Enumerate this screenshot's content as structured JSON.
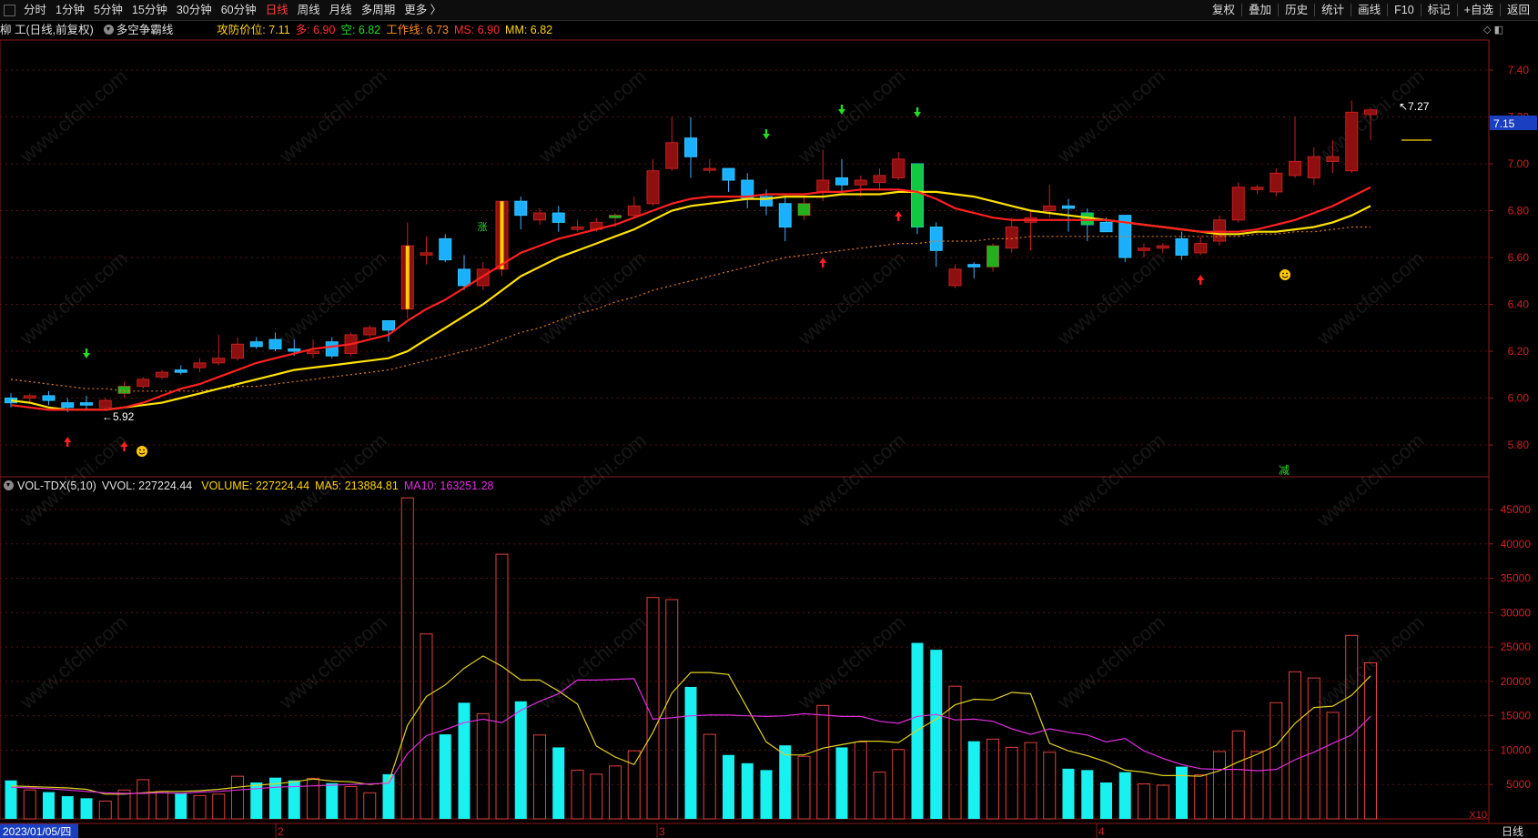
{
  "toolbar": {
    "left": [
      "分时",
      "1分钟",
      "5分钟",
      "15分钟",
      "30分钟",
      "60分钟",
      "日线",
      "周线",
      "月线",
      "多周期",
      "更多 〉"
    ],
    "active": "日线",
    "right": [
      "复权",
      "叠加",
      "历史",
      "统计",
      "画线",
      "F10",
      "标记",
      "+自选",
      "返回"
    ]
  },
  "header": {
    "stock": "柳 工(日线,前复权)",
    "indicator": "多空争霸线",
    "metrics": [
      {
        "label": "攻防价位: ",
        "value": "7.11",
        "color": "#ffd400"
      },
      {
        "label": "多: ",
        "value": "6.90",
        "color": "#ff3030"
      },
      {
        "label": "空: ",
        "value": "6.82",
        "color": "#22dd22"
      },
      {
        "label": "工作线: ",
        "value": "6.73",
        "color": "#ff8c1a"
      },
      {
        "label": "MS: ",
        "value": "6.90",
        "color": "#ff3030"
      },
      {
        "label": "MM: ",
        "value": "6.82",
        "color": "#ffd400"
      }
    ]
  },
  "volume_header": {
    "name": "VOL-TDX(5,10)",
    "vvol": "VVOL: 227224.44",
    "volume": "VOLUME: 227224.44",
    "ma5": "MA5: 213884.81",
    "ma10": "MA10: 163251.28"
  },
  "price_axis": [
    "7.40",
    "7.20",
    "7.00",
    "6.80",
    "6.60",
    "6.40",
    "6.20",
    "6.00",
    "5.80"
  ],
  "current_price": "7.15",
  "high_mark": "7.27",
  "low_mark": "5.92",
  "volume_axis": [
    "45000",
    "40000",
    "35000",
    "30000",
    "25000",
    "20000",
    "15000",
    "10000",
    "5000"
  ],
  "volume_unit": "X10",
  "date_axis": {
    "first": "2023/01/05/四",
    "months": [
      "2",
      "3",
      "4"
    ],
    "period": "日线"
  },
  "signal_texts": {
    "zhang": "涨",
    "jian": "减"
  },
  "chart_data": {
    "type": "candlestick",
    "ylim": [
      5.7,
      7.48
    ],
    "volume_ylim": [
      0,
      48000
    ],
    "candles": [
      [
        6.0,
        5.98,
        6.02,
        5.96
      ],
      [
        6.0,
        6.01,
        6.02,
        5.98
      ],
      [
        6.01,
        5.99,
        6.03,
        5.97
      ],
      [
        5.98,
        5.96,
        6.0,
        5.94
      ],
      [
        5.98,
        5.97,
        6.01,
        5.95
      ],
      [
        5.96,
        5.99,
        6.0,
        5.95
      ],
      [
        6.02,
        6.05,
        6.07,
        6.0
      ],
      [
        6.05,
        6.08,
        6.09,
        6.04
      ],
      [
        6.09,
        6.11,
        6.12,
        6.08
      ],
      [
        6.12,
        6.11,
        6.14,
        6.1
      ],
      [
        6.13,
        6.15,
        6.17,
        6.11
      ],
      [
        6.15,
        6.17,
        6.27,
        6.14
      ],
      [
        6.17,
        6.23,
        6.26,
        6.16
      ],
      [
        6.24,
        6.22,
        6.26,
        6.21
      ],
      [
        6.25,
        6.21,
        6.28,
        6.2
      ],
      [
        6.21,
        6.2,
        6.25,
        6.18
      ],
      [
        6.19,
        6.2,
        6.25,
        6.17
      ],
      [
        6.24,
        6.18,
        6.26,
        6.17
      ],
      [
        6.19,
        6.27,
        6.28,
        6.18
      ],
      [
        6.27,
        6.3,
        6.31,
        6.26
      ],
      [
        6.33,
        6.29,
        6.33,
        6.24
      ],
      [
        6.38,
        6.65,
        6.75,
        6.34
      ],
      [
        6.61,
        6.62,
        6.69,
        6.57
      ],
      [
        6.68,
        6.59,
        6.7,
        6.58
      ],
      [
        6.55,
        6.48,
        6.61,
        6.46
      ],
      [
        6.48,
        6.55,
        6.58,
        6.46
      ],
      [
        6.55,
        6.84,
        6.84,
        6.52
      ],
      [
        6.84,
        6.78,
        6.86,
        6.72
      ],
      [
        6.76,
        6.79,
        6.81,
        6.74
      ],
      [
        6.79,
        6.75,
        6.82,
        6.71
      ],
      [
        6.72,
        6.73,
        6.76,
        6.71
      ],
      [
        6.72,
        6.75,
        6.77,
        6.71
      ],
      [
        6.77,
        6.78,
        6.79,
        6.73
      ],
      [
        6.78,
        6.82,
        6.86,
        6.77
      ],
      [
        6.83,
        6.97,
        7.02,
        6.82
      ],
      [
        6.98,
        7.09,
        7.2,
        6.97
      ],
      [
        7.11,
        7.03,
        7.2,
        6.94
      ],
      [
        6.98,
        6.98,
        7.02,
        6.96
      ],
      [
        6.98,
        6.93,
        6.98,
        6.88
      ],
      [
        6.93,
        6.85,
        6.96,
        6.81
      ],
      [
        6.86,
        6.82,
        6.89,
        6.78
      ],
      [
        6.83,
        6.73,
        6.86,
        6.67
      ],
      [
        6.78,
        6.83,
        6.86,
        6.76
      ],
      [
        6.88,
        6.93,
        7.06,
        6.84
      ],
      [
        6.94,
        6.91,
        7.02,
        6.88
      ],
      [
        6.91,
        6.93,
        6.95,
        6.86
      ],
      [
        6.92,
        6.95,
        6.98,
        6.89
      ],
      [
        6.94,
        7.02,
        7.05,
        6.93
      ],
      [
        7.0,
        6.73,
        7.0,
        6.7
      ],
      [
        6.73,
        6.63,
        6.75,
        6.56
      ],
      [
        6.48,
        6.55,
        6.57,
        6.47
      ],
      [
        6.57,
        6.56,
        6.58,
        6.51
      ],
      [
        6.56,
        6.65,
        6.66,
        6.54
      ],
      [
        6.64,
        6.73,
        6.77,
        6.62
      ],
      [
        6.75,
        6.77,
        6.8,
        6.63
      ],
      [
        6.8,
        6.82,
        6.91,
        6.77
      ],
      [
        6.82,
        6.81,
        6.85,
        6.71
      ],
      [
        6.79,
        6.74,
        6.81,
        6.67
      ],
      [
        6.75,
        6.71,
        6.77,
        6.71
      ],
      [
        6.78,
        6.6,
        6.78,
        6.58
      ],
      [
        6.63,
        6.64,
        6.66,
        6.6
      ],
      [
        6.64,
        6.65,
        6.66,
        6.62
      ],
      [
        6.68,
        6.61,
        6.71,
        6.59
      ],
      [
        6.62,
        6.66,
        6.69,
        6.61
      ],
      [
        6.67,
        6.76,
        6.78,
        6.65
      ],
      [
        6.76,
        6.9,
        6.92,
        6.75
      ],
      [
        6.89,
        6.9,
        6.91,
        6.87
      ],
      [
        6.88,
        6.96,
        6.98,
        6.86
      ],
      [
        6.95,
        7.01,
        7.2,
        6.94
      ],
      [
        6.94,
        7.03,
        7.07,
        6.91
      ],
      [
        7.01,
        7.03,
        7.1,
        6.96
      ],
      [
        6.97,
        7.22,
        7.27,
        6.96
      ],
      [
        7.21,
        7.23,
        7.24,
        7.1
      ]
    ],
    "volumes": [
      5600,
      4200,
      3900,
      3300,
      3000,
      2600,
      4200,
      5700,
      4000,
      3700,
      3400,
      3600,
      6200,
      5300,
      6000,
      5600,
      5900,
      5200,
      4700,
      3800,
      6500,
      46700,
      26900,
      12300,
      16900,
      15300,
      38500,
      17100,
      12200,
      10400,
      7100,
      6500,
      7700,
      9900,
      32200,
      31900,
      19200,
      12300,
      9300,
      8100,
      7100,
      10700,
      9100,
      16500,
      10400,
      11200,
      6800,
      10100,
      25600,
      24600,
      19300,
      11300,
      11600,
      10400,
      11100,
      9700,
      7300,
      7100,
      5300,
      6800,
      5100,
      4900,
      7600,
      6400,
      9800,
      12800,
      9800,
      16900,
      21400,
      20500,
      15500,
      26700,
      22700
    ],
    "series": [
      {
        "name": "多",
        "values": [
          5.97,
          5.96,
          5.95,
          5.95,
          5.95,
          5.95,
          5.96,
          5.98,
          6.01,
          6.04,
          6.06,
          6.09,
          6.12,
          6.15,
          6.17,
          6.19,
          6.21,
          6.22,
          6.23,
          6.25,
          6.27,
          6.33,
          6.38,
          6.42,
          6.47,
          6.52,
          6.57,
          6.62,
          6.65,
          6.68,
          6.7,
          6.72,
          6.74,
          6.77,
          6.8,
          6.83,
          6.85,
          6.86,
          6.86,
          6.86,
          6.87,
          6.87,
          6.87,
          6.88,
          6.88,
          6.89,
          6.89,
          6.89,
          6.88,
          6.85,
          6.81,
          6.79,
          6.77,
          6.76,
          6.76,
          6.76,
          6.76,
          6.76,
          6.76,
          6.75,
          6.74,
          6.73,
          6.72,
          6.71,
          6.71,
          6.71,
          6.72,
          6.74,
          6.76,
          6.79,
          6.82,
          6.86,
          6.9
        ]
      },
      {
        "name": "空",
        "values": [
          5.99,
          5.98,
          5.96,
          5.95,
          5.95,
          5.95,
          5.96,
          5.97,
          5.98,
          6.0,
          6.02,
          6.04,
          6.06,
          6.08,
          6.1,
          6.12,
          6.13,
          6.14,
          6.15,
          6.16,
          6.17,
          6.2,
          6.25,
          6.3,
          6.35,
          6.4,
          6.46,
          6.52,
          6.56,
          6.6,
          6.63,
          6.66,
          6.69,
          6.72,
          6.76,
          6.8,
          6.82,
          6.83,
          6.84,
          6.85,
          6.85,
          6.86,
          6.86,
          6.86,
          6.87,
          6.87,
          6.87,
          6.88,
          6.88,
          6.88,
          6.87,
          6.86,
          6.84,
          6.82,
          6.8,
          6.79,
          6.78,
          6.77,
          6.76,
          6.75,
          6.74,
          6.73,
          6.72,
          6.71,
          6.7,
          6.7,
          6.71,
          6.71,
          6.72,
          6.73,
          6.75,
          6.78,
          6.82
        ]
      },
      {
        "name": "工作线",
        "values": [
          6.08,
          6.07,
          6.06,
          6.05,
          6.04,
          6.04,
          6.03,
          6.03,
          6.03,
          6.03,
          6.03,
          6.04,
          6.05,
          6.05,
          6.06,
          6.07,
          6.08,
          6.09,
          6.1,
          6.11,
          6.12,
          6.14,
          6.16,
          6.18,
          6.2,
          6.22,
          6.25,
          6.28,
          6.3,
          6.33,
          6.36,
          6.38,
          6.41,
          6.43,
          6.46,
          6.48,
          6.5,
          6.52,
          6.54,
          6.56,
          6.58,
          6.6,
          6.61,
          6.62,
          6.63,
          6.64,
          6.65,
          6.66,
          6.66,
          6.67,
          6.67,
          6.67,
          6.68,
          6.68,
          6.69,
          6.69,
          6.69,
          6.69,
          6.69,
          6.69,
          6.69,
          6.69,
          6.69,
          6.69,
          6.69,
          6.69,
          6.7,
          6.7,
          6.71,
          6.71,
          6.72,
          6.73,
          6.73
        ]
      },
      {
        "name": "MA5",
        "values": [
          4800,
          4700,
          4600,
          4500,
          4300,
          3600,
          3600,
          3800,
          4000,
          4000,
          4100,
          4300,
          4600,
          4900,
          5100,
          5400,
          5800,
          5500,
          5400,
          5000,
          5300,
          13600,
          17800,
          19500,
          21900,
          23700,
          22200,
          20200,
          20200,
          18600,
          16700,
          10600,
          9000,
          7900,
          12600,
          18300,
          21300,
          21300,
          21000,
          16100,
          11200,
          9300,
          9300,
          10300,
          10800,
          11300,
          11300,
          11100,
          12900,
          14500,
          16600,
          17400,
          17300,
          18400,
          18200,
          11000,
          9900,
          9200,
          8300,
          7100,
          6800,
          6300,
          6300,
          6200,
          7000,
          8300,
          9400,
          10700,
          13900,
          16200,
          16400,
          18000,
          20800
        ]
      },
      {
        "name": "MA10",
        "values": [
          4600,
          4500,
          4400,
          4200,
          4000,
          3800,
          3700,
          3700,
          3800,
          3700,
          3900,
          4000,
          4200,
          4400,
          4600,
          4700,
          4800,
          4900,
          5000,
          5100,
          5200,
          9500,
          12100,
          13000,
          14000,
          14500,
          14000,
          15800,
          17100,
          18200,
          20200,
          20200,
          20300,
          20400,
          14500,
          14700,
          15000,
          15100,
          15100,
          15000,
          14900,
          15000,
          15300,
          15100,
          14900,
          14900,
          14200,
          13900,
          14900,
          15200,
          14400,
          14500,
          14200,
          13100,
          12300,
          13100,
          12600,
          12200,
          11200,
          11700,
          9900,
          8800,
          7900,
          7300,
          7200,
          7200,
          7000,
          7200,
          8600,
          9700,
          11000,
          12200,
          14900
        ]
      }
    ]
  }
}
